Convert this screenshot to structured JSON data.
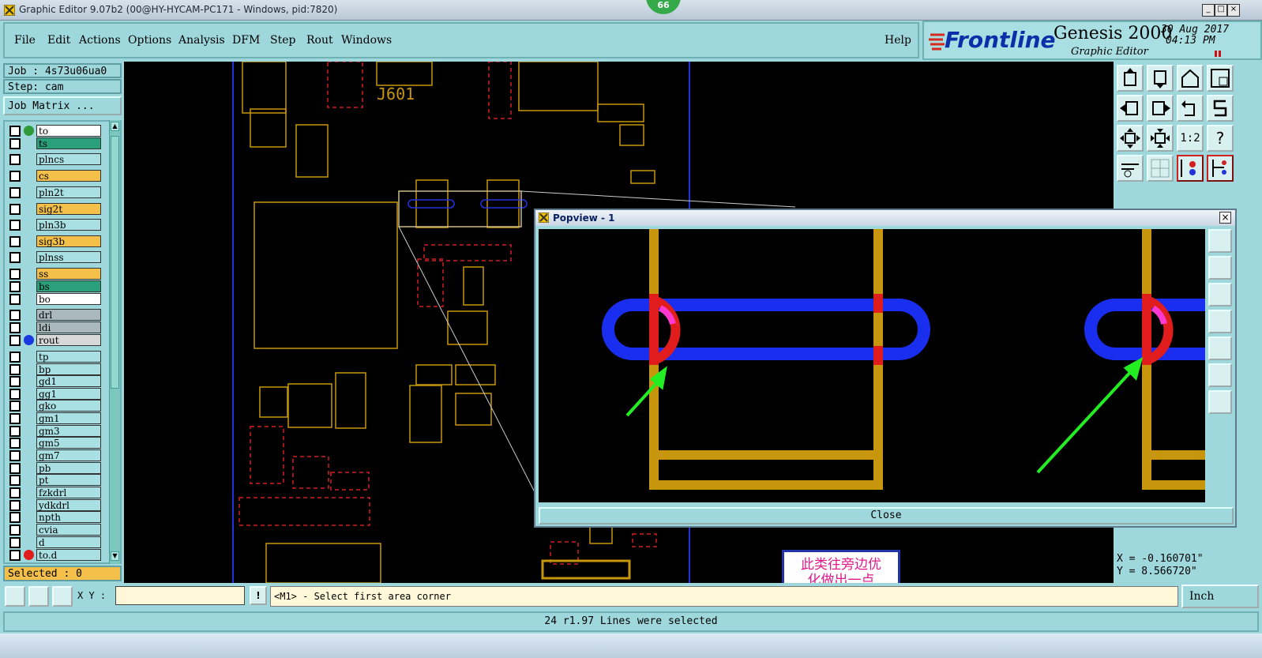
{
  "window": {
    "title": "Graphic Editor 9.07b2 (00@HY-HYCAM-PC171 - Windows, pid:7820)",
    "badge": "66",
    "controls": [
      "_",
      "□",
      "×"
    ]
  },
  "menu": {
    "items": [
      "File",
      "Edit",
      "Actions",
      "Options",
      "Analysis",
      "DFM",
      "Step",
      "Rout",
      "Windows"
    ],
    "help": "Help"
  },
  "brand": {
    "logo": "Frontline",
    "product": "Genesis 2000",
    "subtitle": "Graphic Editor",
    "date": "30 Aug 2017",
    "time": "04:13 PM"
  },
  "job": {
    "job_line": "Job : 4s73u06ua0",
    "step_line": "Step: cam",
    "matrix_button": "Job Matrix ..."
  },
  "layers": [
    {
      "name": "to",
      "bg": "#ffffff",
      "dot": "#2e9a3a"
    },
    {
      "name": "ts",
      "bg": "#2aa07a",
      "dot": ""
    },
    {
      "name": "plncs",
      "bg": "#a8e0e4",
      "dot": ""
    },
    {
      "name": "cs",
      "bg": "#f4c04a",
      "dot": ""
    },
    {
      "name": "pln2t",
      "bg": "#a8e0e4",
      "dot": ""
    },
    {
      "name": "sig2t",
      "bg": "#f4c04a",
      "dot": ""
    },
    {
      "name": "pln3b",
      "bg": "#a8e0e4",
      "dot": ""
    },
    {
      "name": "sig3b",
      "bg": "#f4c04a",
      "dot": ""
    },
    {
      "name": "plnss",
      "bg": "#a8e0e4",
      "dot": ""
    },
    {
      "name": "ss",
      "bg": "#f4c04a",
      "dot": ""
    },
    {
      "name": "bs",
      "bg": "#2aa07a",
      "dot": ""
    },
    {
      "name": "bo",
      "bg": "#ffffff",
      "dot": ""
    },
    {
      "name": "drl",
      "bg": "#a9b8bc",
      "dot": ""
    },
    {
      "name": "ldi",
      "bg": "#a9b8bc",
      "dot": ""
    },
    {
      "name": "rout",
      "bg": "#d8d8d8",
      "dot": "#1a3ae0"
    },
    {
      "name": "tp",
      "bg": "#a8e0e4",
      "dot": ""
    },
    {
      "name": "bp",
      "bg": "#a8e0e4",
      "dot": ""
    },
    {
      "name": "gd1",
      "bg": "#a8e0e4",
      "dot": ""
    },
    {
      "name": "gg1",
      "bg": "#a8e0e4",
      "dot": ""
    },
    {
      "name": "gko",
      "bg": "#a8e0e4",
      "dot": ""
    },
    {
      "name": "gm1",
      "bg": "#a8e0e4",
      "dot": ""
    },
    {
      "name": "gm3",
      "bg": "#a8e0e4",
      "dot": ""
    },
    {
      "name": "gm5",
      "bg": "#a8e0e4",
      "dot": ""
    },
    {
      "name": "gm7",
      "bg": "#a8e0e4",
      "dot": ""
    },
    {
      "name": "pb",
      "bg": "#a8e0e4",
      "dot": ""
    },
    {
      "name": "pt",
      "bg": "#a8e0e4",
      "dot": ""
    },
    {
      "name": "fzkdrl",
      "bg": "#a8e0e4",
      "dot": ""
    },
    {
      "name": "ydkdrl",
      "bg": "#a8e0e4",
      "dot": ""
    },
    {
      "name": "npth",
      "bg": "#a8e0e4",
      "dot": ""
    },
    {
      "name": "cvia",
      "bg": "#a8e0e4",
      "dot": ""
    },
    {
      "name": "d",
      "bg": "#a8e0e4",
      "dot": ""
    },
    {
      "name": "to.d",
      "bg": "#a8e0e4",
      "dot": "#e01c1c"
    }
  ],
  "selected": "Selected : 0",
  "canvas": {
    "label": "J601"
  },
  "popview": {
    "title": "Popview - 1",
    "close": "Close"
  },
  "annotation": {
    "line1": "此类往旁边优",
    "line2": "化做出一点"
  },
  "coords": {
    "x": "X = -0.160701\"",
    "y": "Y = 8.566720\""
  },
  "bottom": {
    "xy_label": "X Y :",
    "xy_value": "",
    "prompt_icon": "!",
    "prompt": "<M1> - Select first area corner",
    "units": "Inch"
  },
  "status": "24 r1.97 Lines were selected",
  "colors": {
    "trace": "#c8960c",
    "red": "#e01c1c",
    "blue": "#1a2ef0",
    "magenta": "#ff38d0",
    "arrow": "#22ee22"
  },
  "tool_icons": [
    "zoom-in-icon",
    "zoom-out-icon",
    "home-icon",
    "fit-window-icon",
    "pan-left-icon",
    "pan-right-icon",
    "redraw-icon",
    "snap-icon",
    "zoom-fit-icon",
    "center-icon",
    "ratio-icon",
    "help-icon",
    "measure-icon",
    "grid-icon",
    "layer-red-icon",
    "layer-blue-icon"
  ],
  "tool_text": {
    "ratio": "1:2",
    "help": "?"
  }
}
